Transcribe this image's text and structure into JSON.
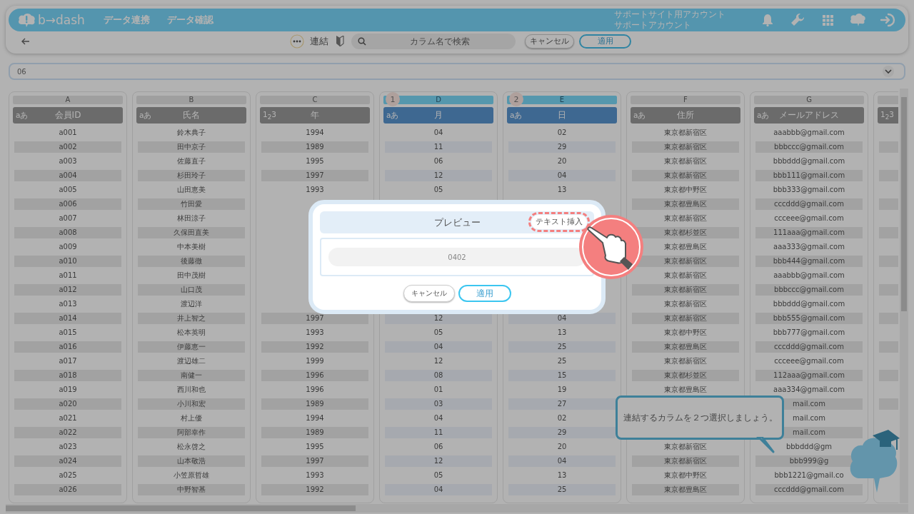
{
  "nav": {
    "logo": "b→dash",
    "links": [
      "データ連携",
      "データ確認"
    ],
    "account": [
      "サポートサイト用アカウント",
      "サポートアカウント"
    ]
  },
  "toolbar": {
    "title": "連結",
    "search": {
      "placeholder": "カラム名で検索"
    },
    "buttons": [
      {
        "label": "キャンセル",
        "kind": "secondary"
      },
      {
        "label": "適用",
        "kind": "primary"
      }
    ]
  },
  "select": {
    "value": "06"
  },
  "columns": [
    {
      "letter": "A",
      "type_label": "aあ",
      "name": "会員ID",
      "selected": false,
      "values": [
        "a001",
        "a002",
        "a003",
        "a004",
        "a005",
        "a006",
        "a007",
        "a008",
        "a009",
        "a010",
        "a011",
        "a012",
        "a013",
        "a014",
        "a015",
        "a016",
        "a017",
        "a018",
        "a019",
        "a020",
        "a021",
        "a022",
        "a023",
        "a024",
        "a025",
        "a026"
      ]
    },
    {
      "letter": "B",
      "type_label": "aあ",
      "name": "氏名",
      "selected": false,
      "values": [
        "鈴木典子",
        "田中京子",
        "佐藤直子",
        "杉田玲子",
        "山田恵美",
        "竹田愛",
        "林田涼子",
        "久保田直美",
        "中本美樹",
        "後藤徹",
        "田中茂樹",
        "山口茂",
        "渡辺洋",
        "井上智之",
        "松本英明",
        "伊藤恵一",
        "渡辺雄二",
        "南健一",
        "西川和也",
        "小川和宏",
        "村上優",
        "阿部幸作",
        "松永啓之",
        "山本敬浩",
        "小笠原哲雄",
        "中野智基"
      ]
    },
    {
      "letter": "C",
      "type_label": "1$_{2}$3",
      "name": "年",
      "selected": false,
      "values": [
        "1994",
        "1989",
        "1995",
        "1997",
        "1993",
        {
          "kind": "covered"
        },
        {
          "kind": "covered"
        },
        {
          "kind": "covered"
        },
        {
          "kind": "covered"
        },
        {
          "kind": "covered"
        },
        {
          "kind": "covered"
        },
        {
          "kind": "covered"
        },
        {
          "kind": "covered"
        },
        "1997",
        "1993",
        "1992",
        "1999",
        "1996",
        "1996",
        "1989",
        "1994",
        "1989",
        "1995",
        "1997",
        "1993",
        "1992"
      ]
    },
    {
      "letter": "D",
      "type_label": "aあ",
      "name": "月",
      "selected": true,
      "order": "1",
      "values": [
        "04",
        "11",
        "06",
        "12",
        "05",
        {
          "kind": "covered"
        },
        {
          "kind": "covered"
        },
        {
          "kind": "covered"
        },
        {
          "kind": "covered"
        },
        {
          "kind": "covered"
        },
        {
          "kind": "covered"
        },
        {
          "kind": "covered"
        },
        {
          "kind": "covered"
        },
        "12",
        "05",
        "04",
        "12",
        "08",
        "01",
        "03",
        "04",
        "11",
        "06",
        "12",
        "05",
        "04"
      ]
    },
    {
      "letter": "E",
      "type_label": "aあ",
      "name": "日",
      "selected": true,
      "order": "2",
      "values": [
        "02",
        "29",
        "20",
        "04",
        "13",
        {
          "kind": "covered"
        },
        {
          "kind": "covered"
        },
        {
          "kind": "covered"
        },
        {
          "kind": "covered"
        },
        {
          "kind": "covered"
        },
        {
          "kind": "covered"
        },
        {
          "kind": "covered"
        },
        {
          "kind": "covered"
        },
        "04",
        "13",
        "25",
        "25",
        "15",
        "19",
        "27",
        "02",
        "29",
        "20",
        "04",
        "13",
        "25"
      ]
    },
    {
      "letter": "F",
      "type_label": "aあ",
      "name": "住所",
      "selected": false,
      "values": [
        "東京都新宿区",
        "東京都新宿区",
        "東京都新宿区",
        "東京都新宿区",
        "東京都中野区",
        "東京都豊島区",
        "東京都新宿区",
        "東京都杉並区",
        "東京都豊島区",
        "東京都新宿区",
        "東京都新宿区",
        "東京都新宿区",
        "東京都新宿区",
        "東京都新宿区",
        "東京都中野区",
        "東京都豊島区",
        "東京都新宿区",
        "東京都杉並区",
        "東京都豊島区",
        {
          "kind": "covered"
        },
        {
          "kind": "covered"
        },
        {
          "kind": "covered"
        },
        "東京都新宿区",
        "東京都新宿区",
        "東京都中野区",
        "東京都豊島区"
      ]
    },
    {
      "letter": "G",
      "type_label": "aあ",
      "name": "メールアドレス",
      "selected": false,
      "values": [
        "aaabbb@gmail.com",
        "bbbccc@gmail.com",
        "bbbddd@gmail.com",
        "bbb111@gmail.com",
        "bbb333@gmail.com",
        "cccddd@gmail.com",
        "ccceee@gmail.com",
        "111aaa@gmail.com",
        "aaa333@gmail.com",
        "bbb444@gmail.com",
        "aaabbb@gmail.com",
        "bbbccc@gmail.com",
        "bbbddd@gmail.com",
        "bbb555@gmail.com",
        "bbb777@gmail.com",
        "cccddd@gmail.com",
        "ccceee@gmail.com",
        "112aaa@gmail.com",
        "aaa334@gmail.com",
        "mail.com",
        "mail.com",
        "mail.com",
        "bbbddd@gm",
        "bbb999@g",
        "bbb1221@gmail.co",
        "cccddd@gmail.com"
      ]
    },
    {
      "type_label": "1$_{2}$3",
      "selected": false,
      "values": [
        {
          "kind": "blank"
        },
        {
          "kind": "blank"
        },
        {
          "kind": "blank"
        },
        {
          "kind": "blank"
        },
        {
          "kind": "blank"
        },
        {
          "kind": "blank"
        },
        {
          "kind": "blank"
        },
        {
          "kind": "blank"
        },
        {
          "kind": "blank"
        },
        {
          "kind": "blank"
        },
        {
          "kind": "blank"
        },
        {
          "kind": "blank"
        },
        {
          "kind": "blank"
        },
        {
          "kind": "blank"
        },
        {
          "kind": "blank"
        },
        {
          "kind": "blank"
        },
        {
          "kind": "blank"
        },
        {
          "kind": "blank"
        },
        {
          "kind": "blank"
        },
        {
          "kind": "blank"
        },
        {
          "kind": "blank"
        },
        {
          "kind": "covered"
        },
        {
          "kind": "covered"
        },
        {
          "kind": "covered"
        },
        {
          "kind": "covered"
        },
        {
          "kind": "covered"
        }
      ]
    }
  ],
  "tip": {
    "text": "連結するカラムを２つ選択しましょう。"
  },
  "dialog": {
    "title": "プレビュー",
    "insert_button": {
      "label": "テキスト挿入",
      "highlighted": true
    },
    "preview": "0402",
    "buttons": [
      {
        "label": "キャンセル",
        "kind": "secondary"
      },
      {
        "label": "適用",
        "kind": "primary"
      }
    ]
  }
}
